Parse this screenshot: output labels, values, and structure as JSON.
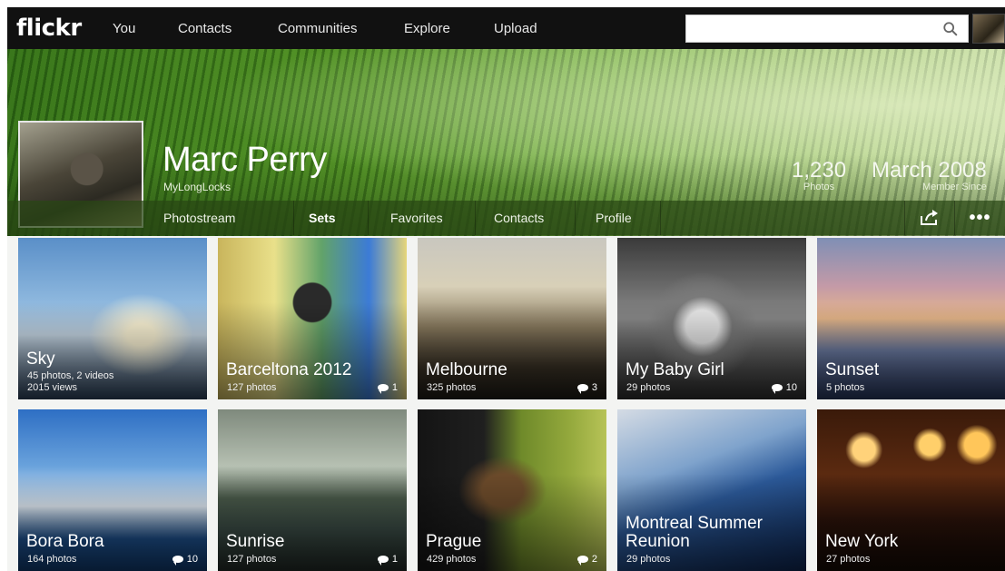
{
  "app": {
    "logo": "flickr"
  },
  "topnav": {
    "items": [
      "You",
      "Contacts",
      "Communities",
      "Explore",
      "Upload"
    ],
    "search_placeholder": ""
  },
  "profile": {
    "name": "Marc Perry",
    "username": "MyLongLocks",
    "stats": [
      {
        "value": "1,230",
        "label": "Photos"
      },
      {
        "value": "March 2008",
        "label": "Member Since"
      }
    ]
  },
  "tabs": {
    "items": [
      "Photostream",
      "Sets",
      "Favorites",
      "Contacts",
      "Profile"
    ],
    "active": "Sets"
  },
  "albums": [
    {
      "title": "Sky",
      "meta": [
        "45 photos, 2 videos",
        "2015 views"
      ],
      "comments": ""
    },
    {
      "title": "Barceltona 2012",
      "meta": [
        "127 photos"
      ],
      "comments": "1"
    },
    {
      "title": "Melbourne",
      "meta": [
        "325 photos"
      ],
      "comments": "3"
    },
    {
      "title": "My Baby Girl",
      "meta": [
        "29 photos"
      ],
      "comments": "10"
    },
    {
      "title": "Sunset",
      "meta": [
        "5 photos"
      ],
      "comments": ""
    },
    {
      "title": "Bora Bora",
      "meta": [
        "164 photos"
      ],
      "comments": "10"
    },
    {
      "title": "Sunrise",
      "meta": [
        "127 photos"
      ],
      "comments": "1"
    },
    {
      "title": "Prague",
      "meta": [
        "429 photos"
      ],
      "comments": "2"
    },
    {
      "title": "Montreal Summer Reunion",
      "meta": [
        "29 photos"
      ],
      "comments": ""
    },
    {
      "title": "New York",
      "meta": [
        "27 photos"
      ],
      "comments": ""
    }
  ],
  "colors": {
    "nav_bg": "#111111",
    "subnav_bg": "#2f4a1a",
    "accent": "#ffffff"
  }
}
